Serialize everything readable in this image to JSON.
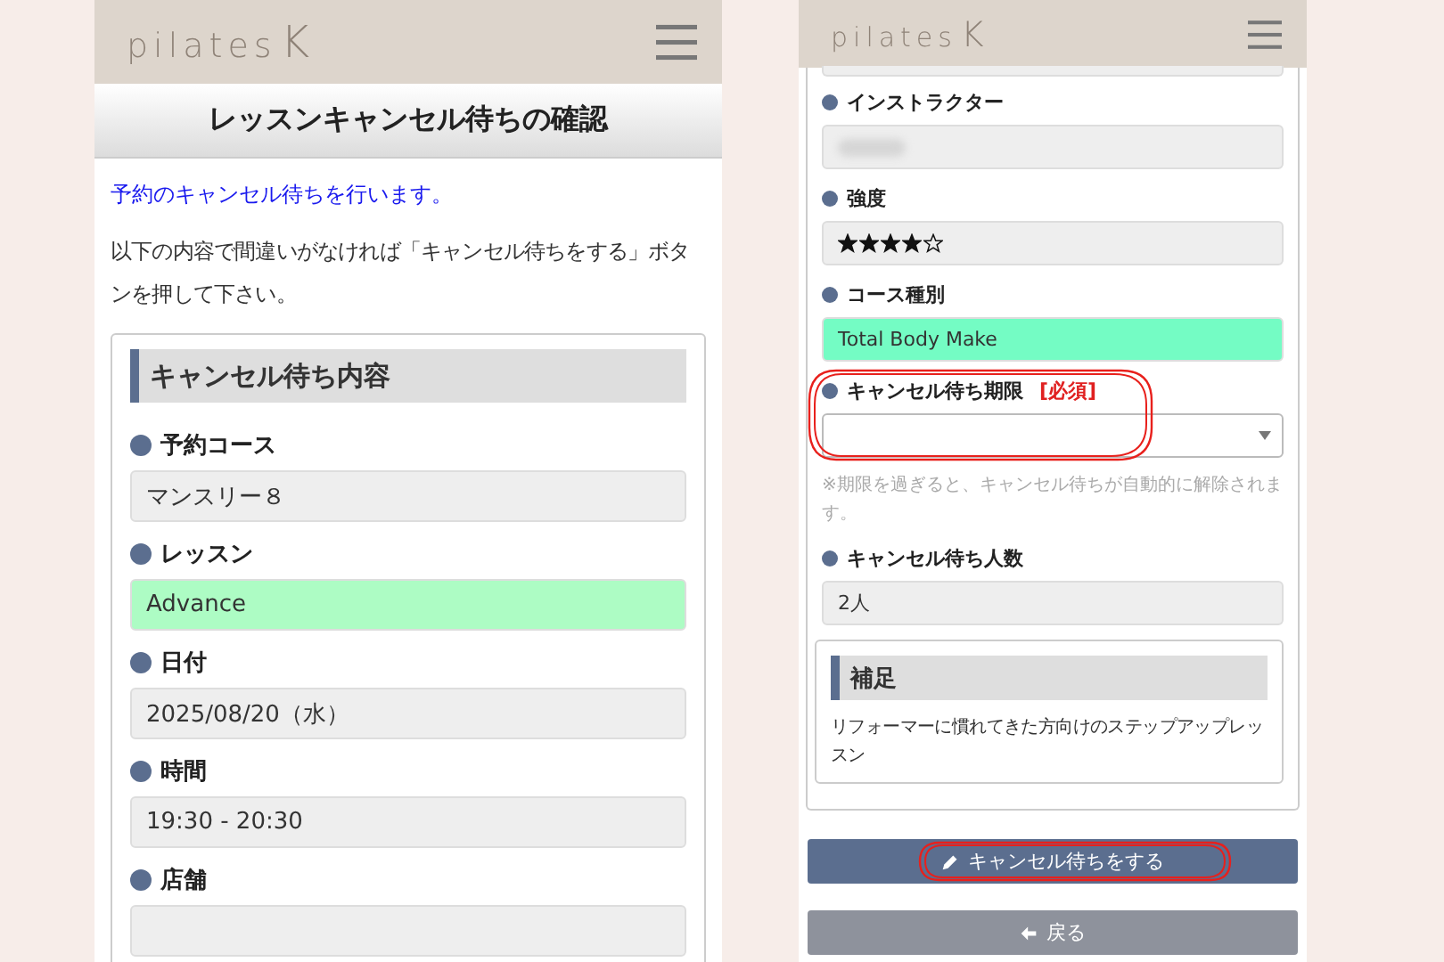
{
  "left_screen": {
    "logo": {
      "text": "pilates",
      "mark": "K"
    },
    "title": "レッスンキャンセル待ちの確認",
    "info": "予約のキャンセル待ちを行います。",
    "instruction": "以下の内容で間違いがなければ「キャンセル待ちをする」ボタンを押して下さい。",
    "card": {
      "heading": "キャンセル待ち内容",
      "fields": [
        {
          "kind": "text",
          "label": "予約コース",
          "value": "マンスリー８"
        },
        {
          "kind": "highlight",
          "label": "レッスン",
          "value": "Advance",
          "color": "#adfcc4"
        },
        {
          "kind": "text",
          "label": "日付",
          "value": "2025/08/20（水）"
        },
        {
          "kind": "text",
          "label": "時間",
          "value": "19:30 - 20:30"
        },
        {
          "kind": "cut",
          "label": "店舗"
        }
      ]
    }
  },
  "right_screen": {
    "logo": {
      "text": "pilates",
      "mark": "K"
    },
    "fields": [
      {
        "kind": "blurred",
        "label": "インストラクター"
      },
      {
        "kind": "stars",
        "label": "強度",
        "stars": 4
      },
      {
        "kind": "highlight",
        "label": "コース種別",
        "value": "Total Body Make",
        "color": "#74fcc4"
      },
      {
        "kind": "select",
        "label": "キャンセル待ち期限",
        "required_tag": "[必須]",
        "note": "※期限を過ぎると、キャンセル待ちが自動的に解除されます。"
      },
      {
        "kind": "text",
        "label": "キャンセル待ち人数",
        "value": "2人"
      }
    ],
    "supplement": {
      "heading": "補足",
      "text": "リフォーマーに慣れてきた方向けのステップアップレッスン"
    },
    "buttons": [
      {
        "kind": "primary",
        "label": "キャンセル待ちをする"
      },
      {
        "kind": "back",
        "label": "戻る"
      }
    ]
  }
}
